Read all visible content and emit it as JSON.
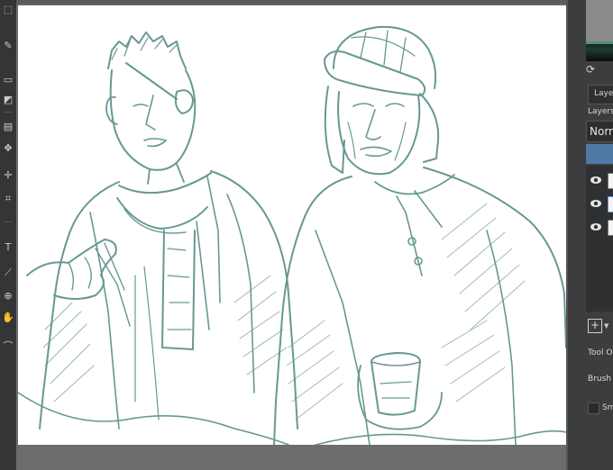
{
  "app": {
    "accent_color": "#4f7aa8",
    "sketch_color": "#4d8780",
    "paper_color": "#ffffff"
  },
  "toolbox": {
    "icons": [
      "freehand-selection-icon",
      "brush-icon",
      "eraser-icon",
      "fill-icon",
      "gradient-icon",
      "transform-icon",
      "move-icon",
      "crop-icon",
      "text-icon",
      "measure-icon",
      "zoom-icon",
      "pan-icon"
    ]
  },
  "docker": {
    "layers_tab_label": "Laye",
    "layers_header": "Layers",
    "blend_mode": "Norm",
    "tool_options_label": "Tool O",
    "brush_label": "Brush",
    "smoothing_label": "Sm",
    "layers": [
      {
        "visible": true,
        "selected": false
      },
      {
        "visible": true,
        "selected": true
      },
      {
        "visible": true,
        "selected": false
      }
    ]
  }
}
